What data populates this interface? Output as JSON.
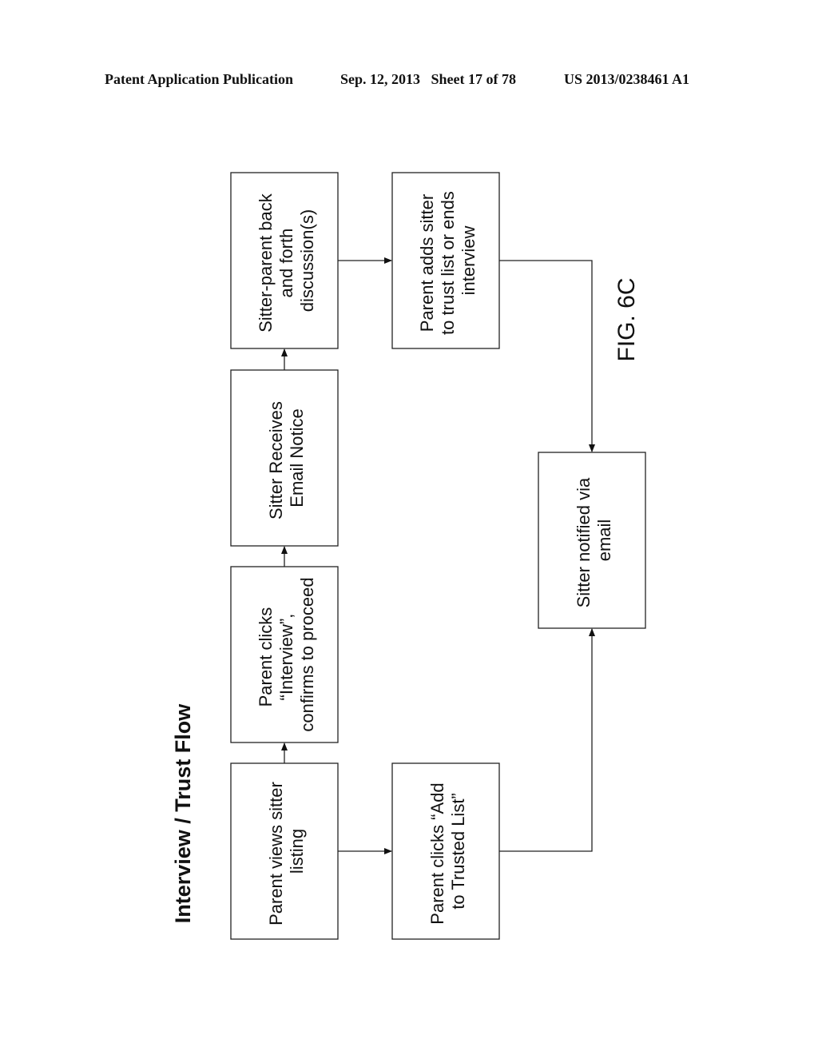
{
  "header": {
    "left": "Patent Application Publication",
    "middle": "Sep. 12, 2013   Sheet 17 of 78",
    "right": "US 2013/0238461 A1"
  },
  "diagram": {
    "title": "Interview / Trust Flow",
    "figure_label": "FIG. 6C",
    "nodes": [
      {
        "id": "view-listing",
        "lines": [
          "Parent views sitter",
          "listing"
        ]
      },
      {
        "id": "click-interview",
        "lines": [
          "Parent clicks",
          "“Interview”,",
          "confirms to proceed"
        ]
      },
      {
        "id": "email-notice",
        "lines": [
          "Sitter Receives",
          "Email Notice"
        ]
      },
      {
        "id": "discussion",
        "lines": [
          "Sitter-parent back",
          "and forth",
          "discussion(s)"
        ]
      },
      {
        "id": "add-or-end",
        "lines": [
          "Parent adds sitter",
          "to trust list or ends",
          "interview"
        ]
      },
      {
        "id": "click-add-trusted",
        "lines": [
          "Parent clicks “Add",
          "to Trusted List”"
        ]
      },
      {
        "id": "notified-email",
        "lines": [
          "Sitter notified via",
          "email"
        ]
      }
    ],
    "edges": [
      {
        "from": "view-listing",
        "to": "click-interview"
      },
      {
        "from": "click-interview",
        "to": "email-notice"
      },
      {
        "from": "email-notice",
        "to": "discussion"
      },
      {
        "from": "discussion",
        "to": "add-or-end"
      },
      {
        "from": "view-listing",
        "to": "click-add-trusted"
      },
      {
        "from": "add-or-end",
        "to": "notified-email"
      },
      {
        "from": "click-add-trusted",
        "to": "notified-email"
      }
    ]
  }
}
